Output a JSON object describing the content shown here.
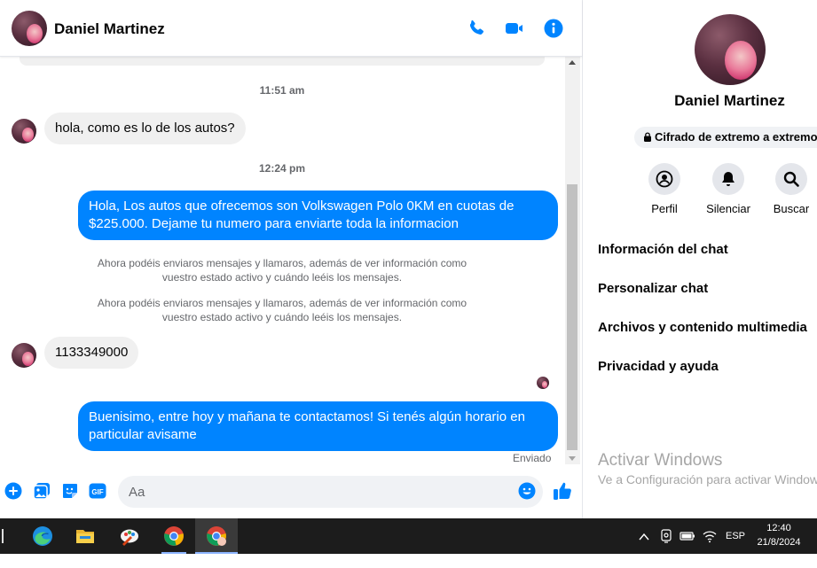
{
  "header": {
    "contact_name": "Daniel Martinez",
    "icons": [
      "phone-icon",
      "video-camera-icon",
      "info-icon"
    ]
  },
  "conversation": {
    "timestamps": [
      "11:51 am",
      "12:24 pm"
    ],
    "incoming": [
      "hola, como es lo de los autos?",
      "1133349000"
    ],
    "outgoing": [
      "Hola, Los autos que ofrecemos son Volkswagen Polo 0KM en cuotas de $225.000. Dejame tu numero para enviarte toda la informacion",
      "Buenisimo, entre hoy y mañana te contactamos! Si tenés algún horario en particular avisame"
    ],
    "system_notes": [
      "Ahora podéis enviaros mensajes y llamaros, además de ver información como vuestro estado activo y cuándo leéis los mensajes.",
      "Ahora podéis enviaros mensajes y llamaros, además de ver información como vuestro estado activo y cuándo leéis los mensajes."
    ],
    "sent_status": "Enviado"
  },
  "composer": {
    "placeholder": "Aa",
    "gif_label": "GIF",
    "icons": [
      "plus-icon",
      "photo-icon",
      "sticker-icon",
      "gif-icon",
      "emoji-icon",
      "thumbs-up-icon"
    ]
  },
  "info_pane": {
    "name": "Daniel Martinez",
    "encryption_badge": "Cifrado de extremo a extremo",
    "actions": [
      {
        "label": "Perfil",
        "icon": "profile-icon"
      },
      {
        "label": "Silenciar",
        "icon": "bell-icon"
      },
      {
        "label": "Buscar",
        "icon": "search-icon"
      }
    ],
    "menu": [
      "Información del chat",
      "Personalizar chat",
      "Archivos y contenido multimedia",
      "Privacidad y ayuda"
    ],
    "watermark_title": "Activar Windows",
    "watermark_sub": "Ve a Configuración para activar Windows."
  },
  "taskbar": {
    "apps": [
      "edge-icon",
      "file-explorer-icon",
      "paint-icon",
      "chrome-icon",
      "chrome-profile-icon"
    ],
    "tray_chevron": "^",
    "language": "ESP",
    "time": "12:40",
    "date": "21/8/2024"
  },
  "colors": {
    "messenger_blue": "#0084ff",
    "incoming_bubble": "#f0f0f0",
    "taskbar": "#1c1c1c"
  }
}
